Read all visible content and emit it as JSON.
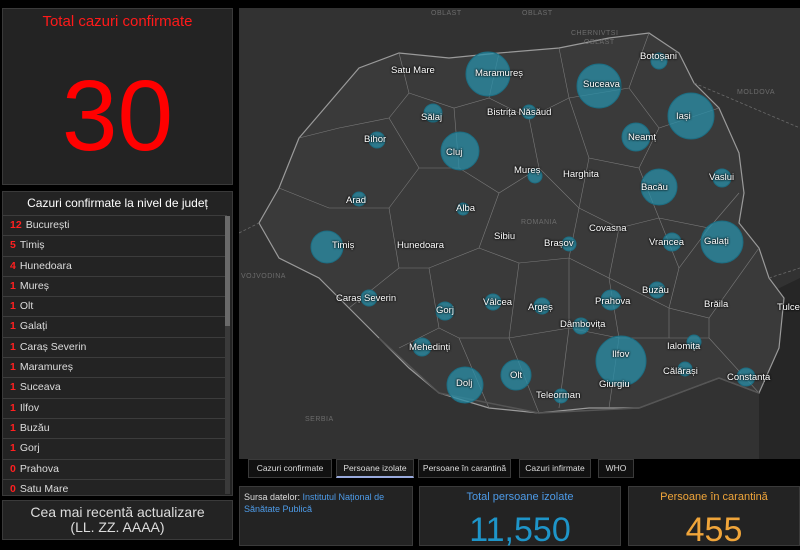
{
  "total": {
    "title": "Total cazuri confirmate",
    "value": "30"
  },
  "county_list": {
    "title": "Cazuri confirmate la nivel de județ",
    "rows": [
      {
        "count": "12",
        "name": "București"
      },
      {
        "count": "5",
        "name": "Timiș"
      },
      {
        "count": "4",
        "name": "Hunedoara"
      },
      {
        "count": "1",
        "name": "Mureș"
      },
      {
        "count": "1",
        "name": "Olt"
      },
      {
        "count": "1",
        "name": "Galați"
      },
      {
        "count": "1",
        "name": "Caraș Severin"
      },
      {
        "count": "1",
        "name": "Maramureș"
      },
      {
        "count": "1",
        "name": "Suceava"
      },
      {
        "count": "1",
        "name": "Ilfov"
      },
      {
        "count": "1",
        "name": "Buzău"
      },
      {
        "count": "1",
        "name": "Gorj"
      },
      {
        "count": "0",
        "name": "Prahova"
      },
      {
        "count": "0",
        "name": "Satu Mare"
      }
    ]
  },
  "update": {
    "line1": "Cea mai recentă actualizare",
    "line2": "(LL. ZZ. AAAA)"
  },
  "map": {
    "region_labels": [
      "OBLAST",
      "OBLAST",
      "CHERNIVTSI",
      "OBLAST",
      "MOLDOVA",
      "ROMANIA",
      "VOJVODINA",
      "SERBIA"
    ],
    "county_labels": [
      "Satu Mare",
      "Maramureș",
      "Suceava",
      "Botoșani",
      "Sălaj",
      "Bistrița Năsăud",
      "Iași",
      "Bihor",
      "Cluj",
      "Neamț",
      "Mureș",
      "Harghita",
      "Vaslui",
      "Bacău",
      "Arad",
      "Alba",
      "Timiș",
      "Hunedoara",
      "Sibiu",
      "Brașov",
      "Covasna",
      "Vrancea",
      "Galați",
      "Caraș Severin",
      "Vâlcea",
      "Argeș",
      "Prahova",
      "Buzău",
      "Brăila",
      "Tulcea",
      "Gorj",
      "Dâmbovița",
      "Mehedinți",
      "Ilfov",
      "Ialomița",
      "Dolj",
      "Olt",
      "Giurgiu",
      "Călărași",
      "Constanța",
      "Teleorman"
    ],
    "bubble_color": "#2a8fa8"
  },
  "tabs": [
    "Cazuri confirmate",
    "Persoane izolate",
    "Persoane în carantină",
    "Cazuri infirmate",
    "WHO"
  ],
  "source": {
    "prefix": "Sursa datelor: ",
    "link": "Institutul Național de Sănătate Publică"
  },
  "isolated": {
    "title": "Total persoane izolate",
    "value": "11,550"
  },
  "quarantine": {
    "title": "Persoane în carantină",
    "value": "455"
  }
}
